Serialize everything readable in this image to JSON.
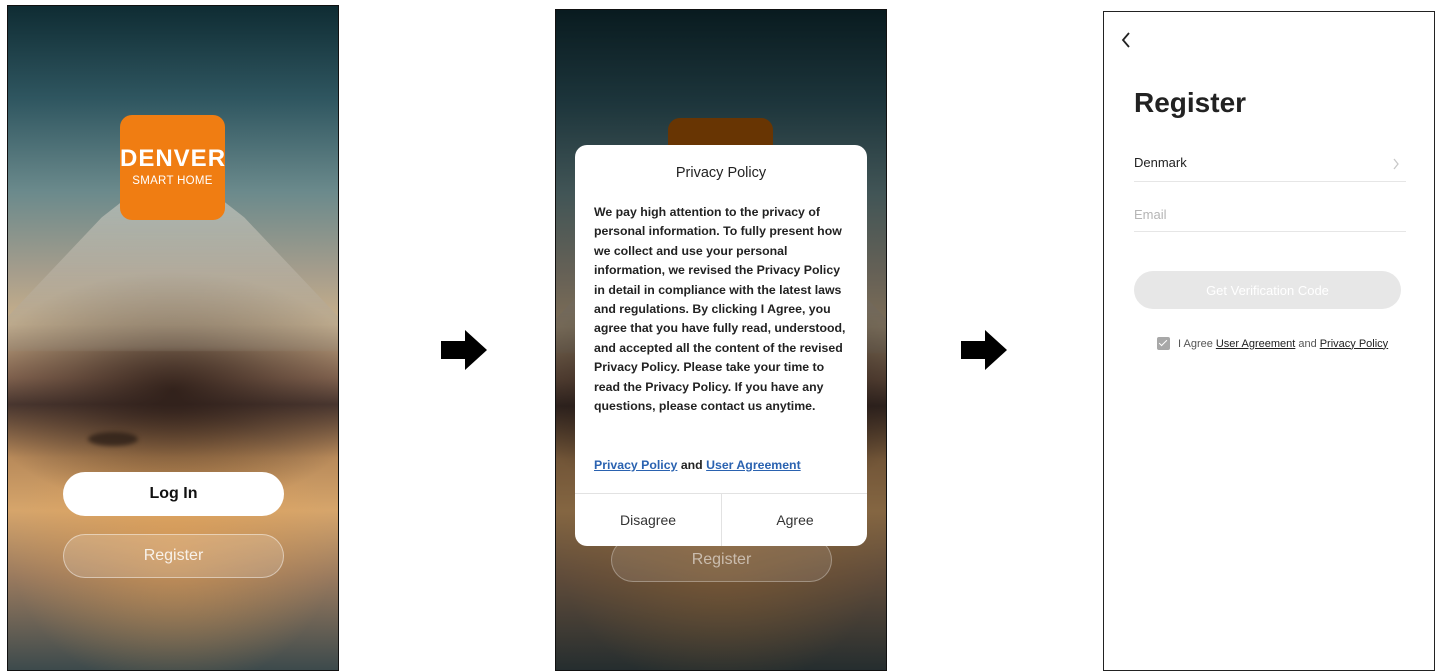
{
  "screen1": {
    "logo_main": "DENVER",
    "logo_sub": "SMART HOME",
    "login_label": "Log In",
    "register_label": "Register"
  },
  "screen2": {
    "register_label": "Register",
    "dialog_title": "Privacy Policy",
    "dialog_body": "We pay high attention to the privacy of personal information. To fully present how we collect and use your personal information, we revised the Privacy Policy in detail in compliance with the latest laws and regulations. By clicking I Agree, you agree that you have fully read, understood, and accepted all the content of the revised Privacy Policy. Please take your time to read the Privacy Policy. If you have any questions, please contact us anytime.",
    "link_privacy": "Privacy Policy",
    "link_and": "and",
    "link_agreement": "User Agreement",
    "disagree_label": "Disagree",
    "agree_label": "Agree"
  },
  "screen3": {
    "title": "Register",
    "country": "Denmark",
    "email_placeholder": "Email",
    "verify_label": "Get Verification Code",
    "agree_prefix": "I Agree",
    "agree_user_agreement": "User Agreement",
    "agree_and": "and",
    "agree_privacy": "Privacy Policy"
  },
  "colors": {
    "brand_orange": "#f07d12",
    "link_blue": "#2a62b0",
    "disabled_gray": "#e7e7e7"
  }
}
